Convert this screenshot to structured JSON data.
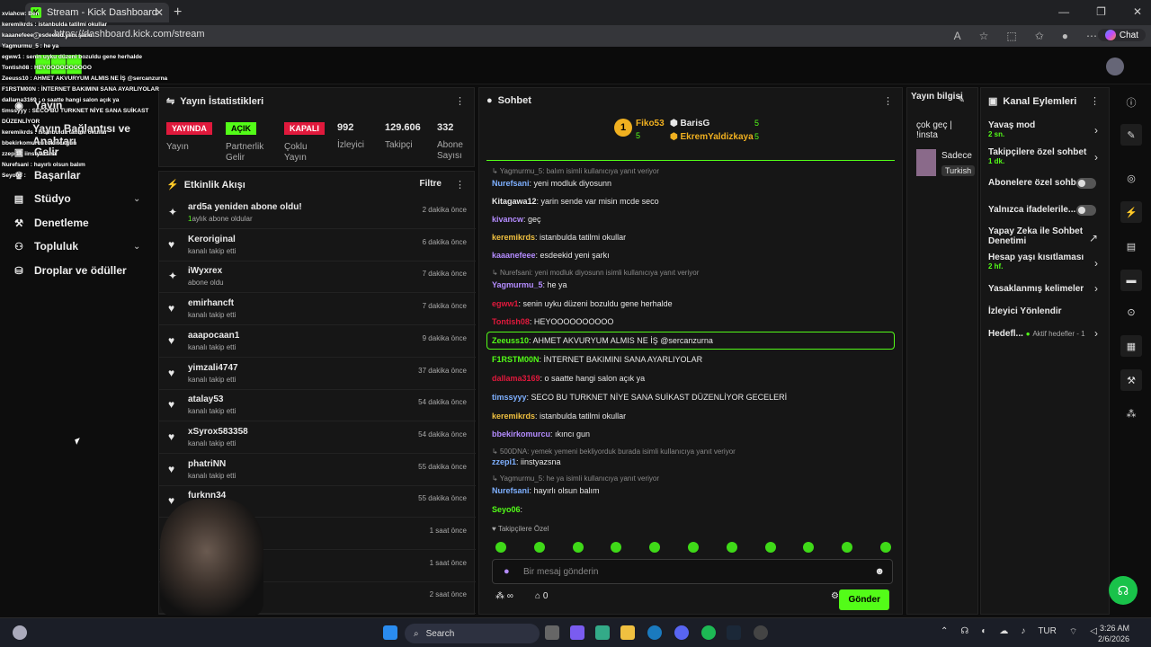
{
  "browser": {
    "tab_title": "Stream - Kick Dashboard",
    "url": "https://dashboard.kick.com/stream",
    "chat_label": "Chat"
  },
  "sidebar": {
    "items": [
      {
        "label": "Yayın",
        "icon": "broadcast-icon"
      },
      {
        "label": "Yayın Bağlantısı ve Anahtarı",
        "icon": "key-icon"
      },
      {
        "label": "Gelir",
        "icon": "coin-icon"
      },
      {
        "label": "Başarılar",
        "icon": "trophy-icon"
      },
      {
        "label": "Stüdyo",
        "icon": "studio-icon"
      },
      {
        "label": "Denetleme",
        "icon": "wrench-icon"
      },
      {
        "label": "Topluluk",
        "icon": "community-icon"
      },
      {
        "label": "Droplar ve ödüller",
        "icon": "gift-icon"
      }
    ]
  },
  "stats": {
    "title": "Yayın İstatistikleri",
    "items": [
      {
        "badge": "YAYINDA",
        "label": "Yayın"
      },
      {
        "badge": "AÇIK",
        "label": "Partnerlik Gelir"
      },
      {
        "badge": "KAPALI",
        "label": "Çoklu Yayın"
      },
      {
        "value": "992",
        "label": "İzleyici"
      },
      {
        "value": "129.606",
        "label": "Takipçi"
      },
      {
        "value": "332",
        "label": "Abone Sayısı"
      }
    ]
  },
  "feed": {
    "title": "Etkinlik Akışı",
    "filter": "Filtre",
    "items": [
      {
        "name": "ard5a yeniden abone oldu!",
        "sub_num": "1",
        "sub": "aylık abone oldular",
        "time": "2 dakika önce",
        "icon": "sparkle-icon"
      },
      {
        "name": "Keroriginal",
        "sub": "kanalı takip etti",
        "time": "6 dakika önce",
        "icon": "heart-icon"
      },
      {
        "name": "iWyxrex",
        "sub": "abone oldu",
        "time": "7 dakika önce",
        "icon": "sparkle-icon"
      },
      {
        "name": "emirhancft",
        "sub": "kanalı takip etti",
        "time": "7 dakika önce",
        "icon": "heart-icon"
      },
      {
        "name": "aaapocaan1",
        "sub": "kanalı takip etti",
        "time": "9 dakika önce",
        "icon": "heart-icon"
      },
      {
        "name": "yimzali4747",
        "sub": "kanalı takip etti",
        "time": "37 dakika önce",
        "icon": "heart-icon"
      },
      {
        "name": "atalay53",
        "sub": "kanalı takip etti",
        "time": "54 dakika önce",
        "icon": "heart-icon"
      },
      {
        "name": "xSyrox583358",
        "sub": "kanalı takip etti",
        "time": "54 dakika önce",
        "icon": "heart-icon"
      },
      {
        "name": "phatriNN",
        "sub": "kanalı takip etti",
        "time": "55 dakika önce",
        "icon": "heart-icon"
      },
      {
        "name": "furknn34",
        "sub": "",
        "time": "55 dakika önce",
        "icon": "heart-icon"
      },
      {
        "name": "",
        "sub": "",
        "time": "1 saat önce",
        "icon": ""
      },
      {
        "name": "",
        "sub": "",
        "time": "1 saat önce",
        "icon": ""
      },
      {
        "name": "",
        "sub": "",
        "time": "2 saat önce",
        "icon": ""
      }
    ]
  },
  "chat": {
    "title": "Sohbet",
    "top": [
      {
        "rank": "1",
        "name": "Fiko53",
        "count": "5"
      },
      {
        "name": "BarisG",
        "count": "5"
      },
      {
        "name": "EkremYaldizkaya",
        "count": "5"
      }
    ],
    "messages": [
      {
        "type": "reply",
        "text": "Yagmurmu_5: balım isimli kullanıcıya yanıt veriyor"
      },
      {
        "user": "Nurefsani",
        "color": "#7eb0ff",
        "text": ": yeni modluk diyosunn"
      },
      {
        "user": "Kitagawa12",
        "color": "#e8e8e8",
        "text": ": yarin sende var misin mcde seco"
      },
      {
        "user": "kivancw",
        "color": "#b48cff",
        "text": ": geç"
      },
      {
        "user": "keremikrds",
        "color": "#f0c040",
        "text": ": istanbulda tatilmi okullar"
      },
      {
        "user": "kaaanefeee",
        "color": "#b48cff",
        "text": ": esdeekid yeni şarkı"
      },
      {
        "type": "reply",
        "text": "Nurefsani: yeni modluk diyosunn   isimli kullanıcıya yanıt veriyor"
      },
      {
        "user": "Yagmurmu_5",
        "color": "#b48cff",
        "text": ": he ya"
      },
      {
        "user": "egww1",
        "color": "#e0193c",
        "text": ": senin uyku düzeni bozuldu gene herhalde"
      },
      {
        "user": "Tontish08",
        "color": "#e0193c",
        "text": ": HEYOOOOOOOOOO"
      },
      {
        "user": "Zeeuss10",
        "color": "#53fc18",
        "text": ": AHMET AKVURYUM ALMIS NE İŞ @sercanzurna",
        "highlight": true
      },
      {
        "user": "F1RSTM00N",
        "color": "#53fc18",
        "text": ": İNTERNET BAKIMINI SANA AYARLIYOLAR"
      },
      {
        "user": "dallama3169",
        "color": "#e0193c",
        "text": ": o saatte hangi salon açık ya"
      },
      {
        "user": "timssyyy",
        "color": "#7eb0ff",
        "text": ": SECO BU TURKNET NİYE SANA SUİKAST DÜZENLİYOR GECELERİ"
      },
      {
        "user": "keremikrds",
        "color": "#f0c040",
        "text": ": istanbulda tatilmi okullar"
      },
      {
        "user": "bbekirkomurcu",
        "color": "#b48cff",
        "text": ": ıkıncı gun"
      },
      {
        "type": "reply",
        "text": "500DNA: yemek yemeni bekliyorduk burada isimli kullanıcıya yanıt veriyor"
      },
      {
        "user": "zzepi1",
        "color": "#7eb0ff",
        "text": ": iinstyazsna"
      },
      {
        "type": "reply",
        "text": "Yagmurmu_5: he ya   isimli kullanıcıya yanıt veriyor"
      },
      {
        "user": "Nurefsani",
        "color": "#7eb0ff",
        "text": ": hayırlı olsun balım"
      },
      {
        "user": "Seyo06",
        "color": "#53fc18",
        "text": ":"
      }
    ],
    "followers_only": "Takipçilere Özel",
    "placeholder": "Bir mesaj gönderin",
    "send": "Gönder",
    "count_zero": "0",
    "infinite": "∞"
  },
  "info": {
    "title": "Yayın bilgisi",
    "text": "çok geç | !insta",
    "card_name": "Sadece",
    "card_tag": "Turkish"
  },
  "actions": {
    "title": "Kanal Eylemleri",
    "items": [
      {
        "label": "Yavaş mod",
        "sub": "2 sn."
      },
      {
        "label": "Takipçilere özel sohbet",
        "sub": "1 dk."
      },
      {
        "label": "Abonelere özel sohbet",
        "toggle": true
      },
      {
        "label": "Yalnızca ifadelerile...",
        "toggle": true
      },
      {
        "label": "Yapay Zeka ile Sohbet Denetimi",
        "sub": ""
      },
      {
        "label": "Hesap yaşı kısıtlaması",
        "sub": "2 hf."
      },
      {
        "label": "Yasaklanmış kelimeler"
      },
      {
        "label": "İzleyici Yönlendir"
      },
      {
        "label": "Hedefl...",
        "sub_inline": "Aktif hedefler - 1"
      }
    ]
  },
  "overlay_lines": [
    "xviahcw: Ben",
    "keremikrds : istanbulda tatilmi okullar",
    "kaaanefeee : esdeekid yeni şarkı",
    "Yagmurmu_5 : he ya",
    "egww1 : senin uyku düzeni bozuldu gene herhalde",
    "Tontish08 : HEYOOOOOOOOOO",
    "Zeeuss10 : AHMET AKVURYUM ALMIS NE İŞ @sercanzurna",
    "F1RSTM00N : İNTERNET BAKIMINI SANA AYARLIYOLAR",
    "dallama3169 : o saatte hangi salon açık ya",
    "timssyyy : SECO BU TURKNET NİYE SANA SUİKAST DÜZENLİYOR",
    "keremikrds : istanbulda tatilmi okullar",
    "bbekirkomurcu : ıkıncı gun",
    "zzepi1 : iinstyazsna",
    "Nurefsani : hayırlı olsun balım",
    "Seyo06 :"
  ],
  "taskbar": {
    "search": "Search",
    "lang": "TUR",
    "time": "3:26 AM",
    "date": "2/6/2026"
  }
}
